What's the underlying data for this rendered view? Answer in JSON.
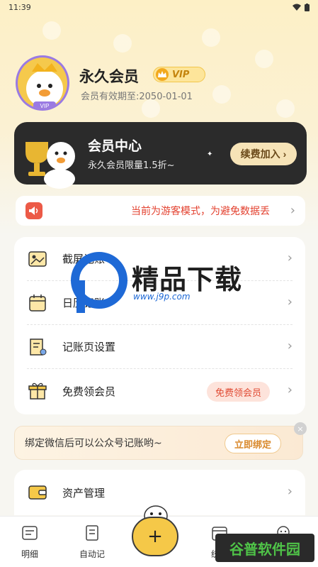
{
  "status_bar": {
    "time": "11:39"
  },
  "profile": {
    "username": "永久会员",
    "vip_badge": "VIP",
    "expiry": "会员有效期至:2050-01-01"
  },
  "vip_card": {
    "title": "会员中心",
    "subtitle": "永久会员限量1.5折~",
    "renew_button": "续费加入"
  },
  "notice": {
    "text": "当前为游客模式，为避免数据丢"
  },
  "menu": {
    "items": [
      {
        "label": "截屏记账",
        "icon": "screenshot-icon"
      },
      {
        "label": "日历记账",
        "icon": "calendar-icon"
      },
      {
        "label": "记账页设置",
        "icon": "document-settings-icon"
      },
      {
        "label": "免费领会员",
        "icon": "gift-icon",
        "tag": "免费领会员"
      }
    ]
  },
  "bind_banner": {
    "text": "绑定微信后可以公众号记账哟~",
    "button": "立即绑定",
    "close": "×"
  },
  "asset": {
    "label": "资产管理"
  },
  "tabs": [
    {
      "label": "明细"
    },
    {
      "label": "自动记"
    },
    {
      "label": "统计"
    },
    {
      "label": "我的"
    }
  ],
  "fab": {
    "symbol": "+"
  },
  "watermark": {
    "brand": "精品下载",
    "url": "www.j9p.com"
  },
  "corner_watermark": {
    "text": "谷普软件园"
  },
  "colors": {
    "accent": "#f5c848",
    "dark_card": "#2b2b2b",
    "alert_red": "#e3412f"
  }
}
